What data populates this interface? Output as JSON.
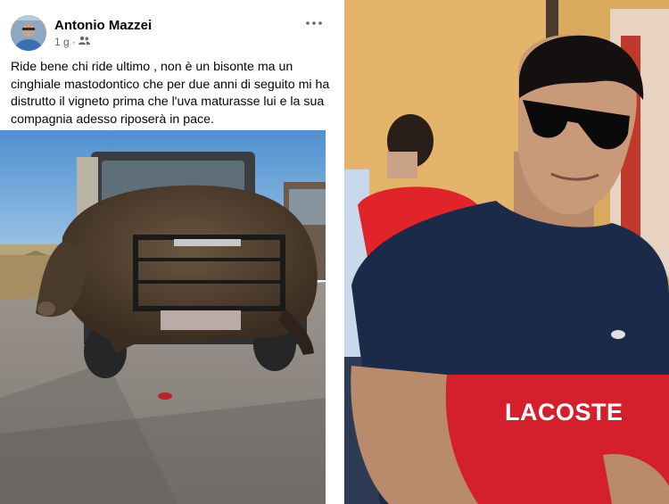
{
  "post": {
    "author": "Antonio Mazzei",
    "time": "1 g",
    "separator": "·",
    "audience_icon": "friends-icon",
    "more_icon": "more-dots-icon",
    "text": "Ride bene chi ride ultimo ,  non è un bisonte ma un cinghiale mastodontico che per due anni di seguito mi ha distrutto il vigneto prima che l'uva maturasse lui e la sua compagnia adesso riposerà in pace."
  },
  "portrait": {
    "shirt_text": "LACOSTE"
  },
  "colors": {
    "author_text": "#050505",
    "meta_text": "#65676b",
    "sky": "#6ea6d8",
    "road": "#8a8580",
    "boar": "#4a3a2c",
    "wall": "#e3b46a",
    "shirt_navy": "#1c2a4a",
    "shirt_red": "#d4202c"
  }
}
